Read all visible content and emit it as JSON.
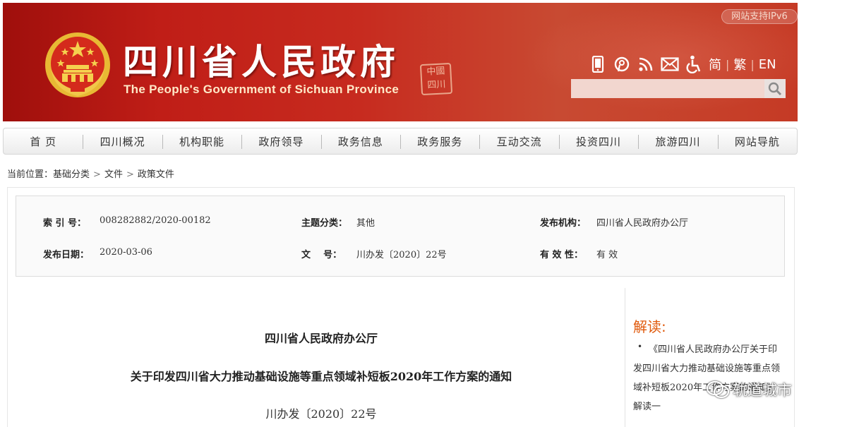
{
  "header": {
    "title": "四川省人民政府",
    "subtitle": "The People's Government of Sichuan Province",
    "seal_text": "中国 四川",
    "ipv6_badge": "网站支持IPv6",
    "tool_icons": [
      "mobile-icon",
      "weibo-icon",
      "rss-icon",
      "mail-icon",
      "accessibility-icon"
    ],
    "lang_simplified": "简",
    "lang_traditional": "繁",
    "lang_english": "EN",
    "search_placeholder": "",
    "colors": {
      "banner": "#c01e17",
      "accent_orange": "#e05a0c"
    }
  },
  "nav": {
    "items": [
      {
        "label": "首  页"
      },
      {
        "label": "四川概况"
      },
      {
        "label": "机构职能"
      },
      {
        "label": "政府领导"
      },
      {
        "label": "政务信息"
      },
      {
        "label": "政务服务"
      },
      {
        "label": "互动交流"
      },
      {
        "label": "投资四川"
      },
      {
        "label": "旅游四川"
      },
      {
        "label": "网站导航"
      }
    ]
  },
  "breadcrumb": {
    "prefix": "当前位置：",
    "items": [
      "基础分类",
      "文件",
      "政策文件"
    ]
  },
  "meta": {
    "index_label": "索 引 号：",
    "index_value": "008282882/2020-00182",
    "topic_label": "主题分类：",
    "topic_value": "其他",
    "publisher_label": "发布机构：",
    "publisher_value": "四川省人民政府办公厅",
    "date_label": "发布日期：",
    "date_value": "2020-03-06",
    "docnum_label": "文    号：",
    "docnum_value": "川办发〔2020〕22号",
    "validity_label": "有 效 性：",
    "validity_value": "有 效"
  },
  "document": {
    "org": "四川省人民政府办公厅",
    "title": "关于印发四川省大力推动基础设施等重点领域补短板2020年工作方案的通知",
    "number": "川办发〔2020〕22号"
  },
  "interpretation": {
    "title": "解读:",
    "bullet": "•",
    "link_text": "《四川省人民政府办公厅关于印发四川省大力推动基础设施等重点领域补短板2020年工作方案的通知》解读一"
  },
  "watermark": {
    "text": "轨道城市"
  }
}
